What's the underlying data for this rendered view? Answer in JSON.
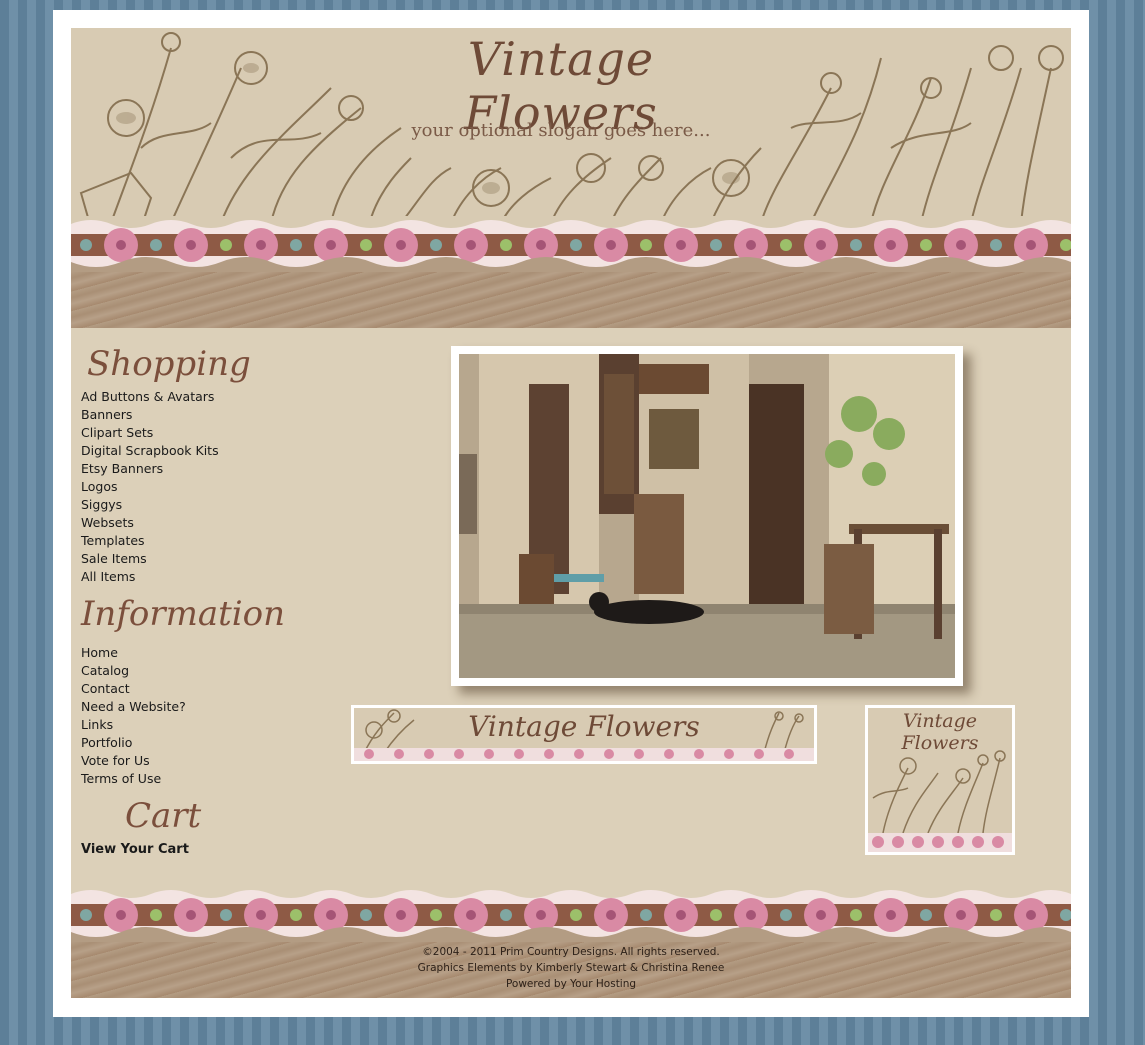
{
  "header": {
    "title": "Vintage Flowers",
    "slogan": "your optional slogan goes here..."
  },
  "sidebar": {
    "shopping": {
      "heading": "Shopping",
      "items": [
        "Ad Buttons & Avatars",
        "Banners",
        "Clipart Sets",
        "Digital Scrapbook Kits",
        "Etsy Banners",
        "Logos",
        "Siggys",
        "Websets",
        "Templates",
        "Sale Items",
        "All Items"
      ]
    },
    "information": {
      "heading": "Information",
      "items": [
        "Home",
        "Catalog",
        "Contact",
        "Need a Website?",
        "Links",
        "Portfolio",
        "Vote for Us",
        "Terms of Use"
      ]
    },
    "cart": {
      "heading": "Cart",
      "link": "View Your Cart"
    }
  },
  "previews": {
    "banner_title": "Vintage Flowers",
    "avatar_title": "Vintage Flowers"
  },
  "footer": {
    "copyright": "©2004 - 2011 Prim Country Designs. All rights reserved.",
    "credits": "Graphics Elements by Kimberly Stewart & Christina Renee",
    "powered": "Powered by Your Hosting"
  },
  "colors": {
    "background_stripes": "#5d7f98",
    "page": "#dcd0b9",
    "heading_brown": "#7b4f3c",
    "flower_pink": "#d98aa4"
  },
  "icons": [
    "wildflower-sketch",
    "lace-flower-border",
    "shop-doorway-photo"
  ]
}
